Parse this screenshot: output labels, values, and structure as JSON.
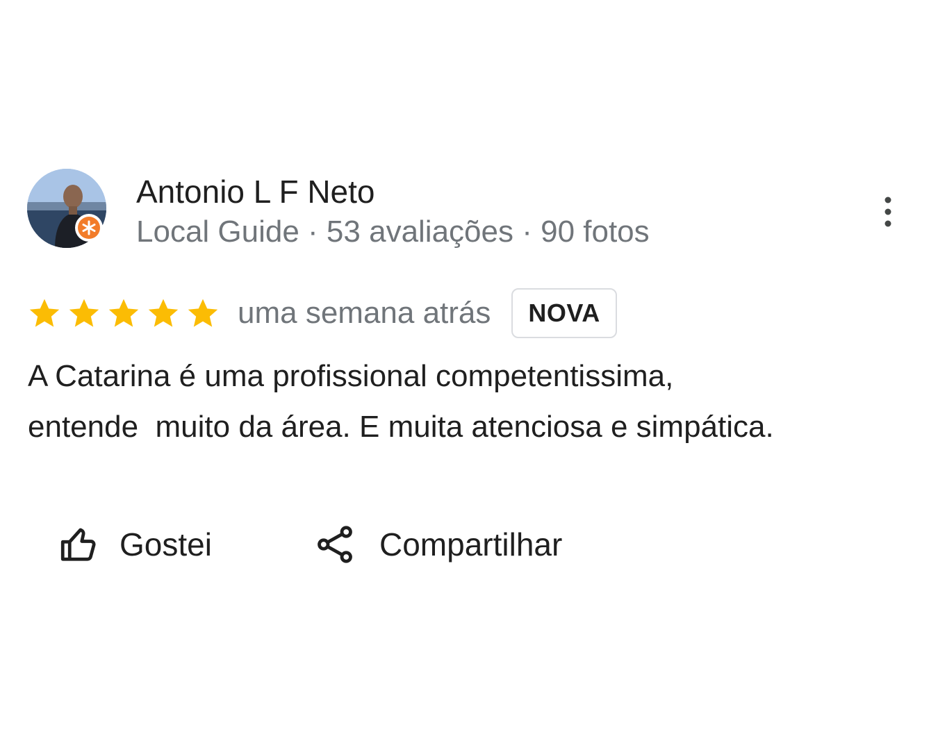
{
  "reviewer": {
    "name": "Antonio L F Neto",
    "meta": "Local Guide · 53 avaliações · 90 fotos",
    "badge_icon": "local-guide-star-icon",
    "badge_color": "#f27c2a"
  },
  "rating": {
    "stars": 5,
    "max_stars": 5,
    "star_color": "#fbbc04",
    "date": "uma semana atrás",
    "new_badge": "NOVA"
  },
  "review": {
    "text": "A Catarina é uma profissional competentissima,\nentende  muito da área. E muita atenciosa e simpática."
  },
  "actions": {
    "like_label": "Gostei",
    "like_icon": "thumbs-up-icon",
    "share_label": "Compartilhar",
    "share_icon": "share-icon",
    "more_icon": "more-vertical-icon"
  }
}
